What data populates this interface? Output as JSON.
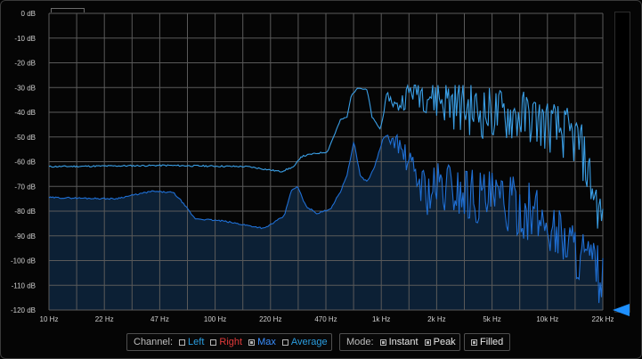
{
  "analyzer": {
    "y_axis": {
      "labels": [
        "0 dB",
        "-10 dB",
        "-20 dB",
        "-30 dB",
        "-40 dB",
        "-50 dB",
        "-60 dB",
        "-70 dB",
        "-80 dB",
        "-90 dB",
        "-100 dB",
        "-110 dB",
        "-120 dB"
      ],
      "min": -120,
      "max": 0
    },
    "x_axis": {
      "labels": [
        "10 Hz",
        "22 Hz",
        "47 Hz",
        "100 Hz",
        "220 Hz",
        "470 Hz",
        "1k Hz",
        "2k Hz",
        "5k Hz",
        "10k Hz",
        "22k Hz"
      ],
      "scale": "log",
      "min_hz": 10,
      "max_hz": 22000
    },
    "colors": {
      "grid": "#5a5a5a",
      "max_trace": "#3a9fe6",
      "average_trace": "#1f6fd4",
      "fill": "#0d2238",
      "accent": "#1e8fff"
    }
  },
  "controls": {
    "channel": {
      "label": "Channel:",
      "options": [
        {
          "label": "Left",
          "checked": false
        },
        {
          "label": "Right",
          "checked": false
        },
        {
          "label": "Max",
          "checked": true
        },
        {
          "label": "Average",
          "checked": false
        }
      ]
    },
    "mode": {
      "label": "Mode:",
      "options": [
        {
          "label": "Instant",
          "checked": true
        },
        {
          "label": "Peak",
          "checked": true
        }
      ]
    },
    "filled": {
      "label": "Filled",
      "checked": true
    }
  }
}
